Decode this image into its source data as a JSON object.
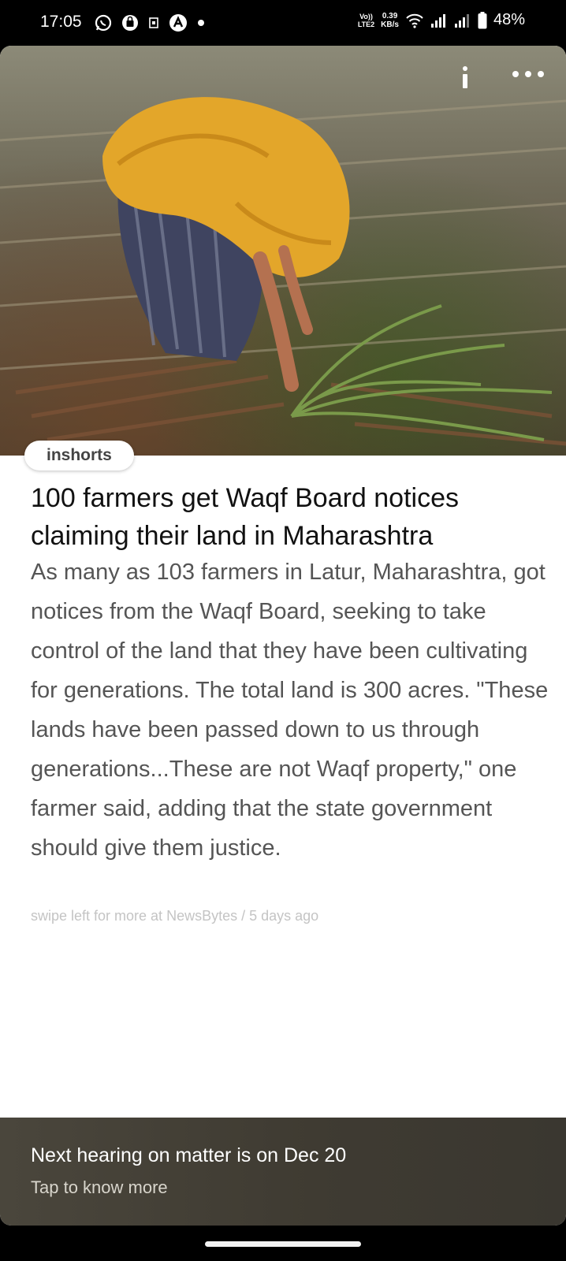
{
  "status_bar": {
    "time": "17:05",
    "network_label_top": "Vo))",
    "network_label_bottom": "LTE2",
    "speed_value": "0.39",
    "speed_unit": "KB/s",
    "battery_percent": "48%"
  },
  "article": {
    "source_badge": "inshorts",
    "headline": "100 farmers get Waqf Board notices claiming their land in Maharashtra",
    "body": "As many as 103 farmers in Latur, Maharashtra, got notices from the Waqf Board, seeking to take control of the land that they have been cultivating for generations. The total land is 300 acres. \"These lands have been passed down to us through generations...These are not Waqf property,\" one farmer said, adding that the state government should give them justice.",
    "meta": "swipe left for more at NewsBytes / 5 days ago"
  },
  "footer": {
    "title": "Next hearing on matter is on Dec 20",
    "subtitle": "Tap to know more"
  },
  "colors": {
    "headline": "#111111",
    "body": "#555555",
    "footer_bg": "#433f36"
  }
}
